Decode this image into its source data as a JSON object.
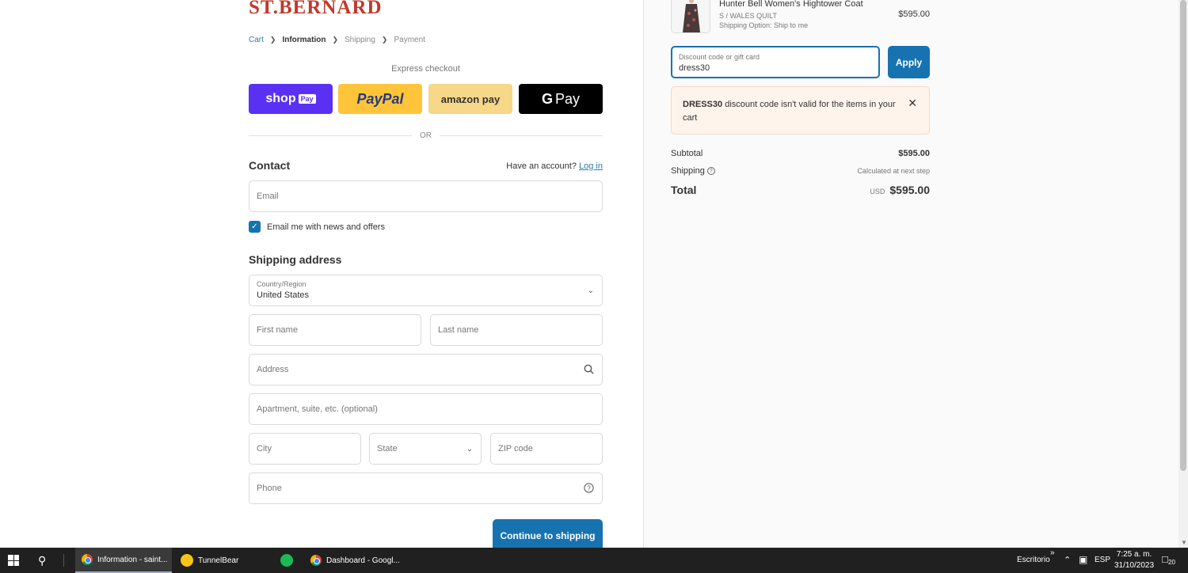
{
  "brand": {
    "logo_text": "ST.BERNARD",
    "logo_color": "#c0392b"
  },
  "breadcrumb": {
    "cart": "Cart",
    "information": "Information",
    "shipping": "Shipping",
    "payment": "Payment"
  },
  "express": {
    "title": "Express checkout",
    "shoppay": "shop",
    "shoppay_tag": "Pay",
    "paypal": "PayPal",
    "amazonpay": "amazon pay",
    "gpay_g": "G",
    "gpay": "Pay",
    "or": "OR"
  },
  "contact": {
    "title": "Contact",
    "have_account": "Have an account?",
    "login": "Log in",
    "email_placeholder": "Email",
    "news_label": "Email me with news and offers",
    "news_checked": true
  },
  "shipping_address": {
    "title": "Shipping address",
    "country_label": "Country/Region",
    "country_value": "United States",
    "first_name": "First name",
    "last_name": "Last name",
    "address": "Address",
    "apartment": "Apartment, suite, etc. (optional)",
    "city": "City",
    "state": "State",
    "zip": "ZIP code",
    "phone": "Phone"
  },
  "continue_button": "Continue to shipping",
  "order": {
    "product_title": "Hunter Bell Women's Hightower Coat",
    "product_variant": "S / WALES QUILT",
    "product_shipping": "Shipping Option: Ship to me",
    "product_price": "$595.00",
    "discount_label": "Discount code or gift card",
    "discount_value": "dress30",
    "apply": "Apply",
    "error_code": "DRESS30",
    "error_text": " discount code isn't valid for the items in your cart",
    "subtotal_label": "Subtotal",
    "subtotal_value": "$595.00",
    "shipping_label": "Shipping",
    "shipping_value": "Calculated at next step",
    "total_label": "Total",
    "total_currency": "USD",
    "total_value": "$595.00"
  },
  "taskbar": {
    "items": [
      {
        "label": "Information - saint...",
        "icon": "chrome-icon"
      },
      {
        "label": "TunnelBear",
        "icon": "tunnelbear-icon"
      },
      {
        "label": "",
        "icon": "spotify-icon"
      },
      {
        "label": "Dashboard - Googl...",
        "icon": "chrome-icon"
      }
    ],
    "desktop": "Escritorio",
    "lang": "ESP",
    "time": "7:25 a. m.",
    "date": "31/10/2023",
    "notif_count": "20"
  },
  "colors": {
    "accent": "#1773b0",
    "shoppay": "#5a31f4",
    "paypal": "#ffc439",
    "amazon": "#f7d788",
    "error_bg": "#fff4ec"
  }
}
